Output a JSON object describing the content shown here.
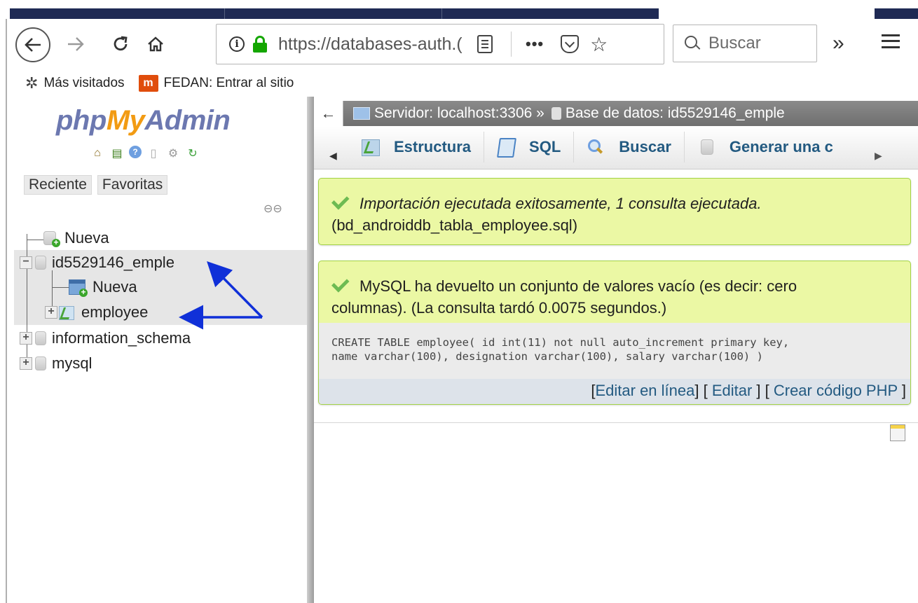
{
  "browser": {
    "url": "https://databases-auth.(",
    "search_placeholder": "Buscar",
    "bookmarks": [
      {
        "label": "Más visitados"
      },
      {
        "label": "FEDAN: Entrar al sitio",
        "icon_letter": "m"
      }
    ]
  },
  "sidebar": {
    "logo_php": "php",
    "logo_my": "My",
    "logo_admin": "Admin",
    "tabs": [
      "Reciente",
      "Favoritas"
    ],
    "tree": [
      {
        "label": "Nueva"
      },
      {
        "label": "id5529146_emple",
        "expanded": true,
        "selected": true
      },
      {
        "label": "Nueva"
      },
      {
        "label": "employee"
      },
      {
        "label": "information_schema"
      },
      {
        "label": "mysql"
      }
    ]
  },
  "main": {
    "breadcrumb": {
      "server": "Servidor: localhost:3306 »",
      "database": "Base de datos: id5529146_emple"
    },
    "tabs": [
      "Estructura",
      "SQL",
      "Buscar",
      "Generar una c"
    ],
    "messages": {
      "import_line1": "Importación ejecutada exitosamente, 1 consulta ejecutada.",
      "import_line2": "(bd_androiddb_tabla_employee.sql)",
      "result_line1": "MySQL ha devuelto un conjunto de valores vacío (es decir: cero",
      "result_line2": "columnas). (La consulta tardó 0.0075 segundos.)"
    },
    "sql": {
      "line1": "CREATE TABLE employee( id int(11) not null auto_increment primary key,",
      "line2": "name varchar(100), designation varchar(100), salary varchar(100) )"
    },
    "sql_links": {
      "edit_inline": "Editar en línea",
      "edit": "Editar",
      "create_php": "Crear código PHP"
    }
  },
  "colors": {
    "success_bg": "#ebf8a4",
    "link": "#235a81",
    "annotation_arrow": "#1030d8"
  }
}
